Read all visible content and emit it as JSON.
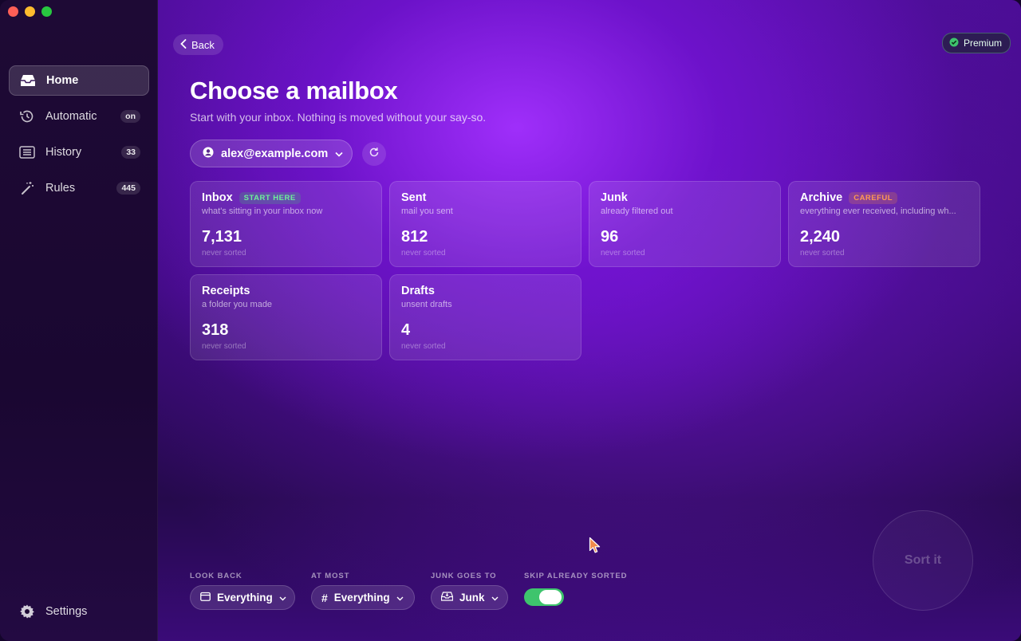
{
  "sidebar": {
    "items": [
      {
        "label": "Home",
        "icon": "inbox-tray-icon",
        "badge": ""
      },
      {
        "label": "Automatic",
        "icon": "history-clock-icon",
        "badge": "on"
      },
      {
        "label": "History",
        "icon": "list-icon",
        "badge": "33"
      },
      {
        "label": "Rules",
        "icon": "magic-wand-icon",
        "badge": "445"
      }
    ],
    "settings_label": "Settings"
  },
  "header": {
    "back_label": "Back",
    "premium_label": "Premium",
    "title": "Choose a mailbox",
    "subtitle": "Start with your inbox. Nothing is moved without your say-so."
  },
  "account": {
    "email": "alex@example.com"
  },
  "mailboxes": [
    {
      "name": "Inbox",
      "tag": "START HERE",
      "desc": "what's sitting in your inbox now",
      "count": "7,131",
      "status": "never sorted"
    },
    {
      "name": "Sent",
      "tag": "",
      "desc": "mail you sent",
      "count": "812",
      "status": "never sorted"
    },
    {
      "name": "Junk",
      "tag": "",
      "desc": "already filtered out",
      "count": "96",
      "status": "never sorted"
    },
    {
      "name": "Archive",
      "tag": "CAREFUL",
      "desc": "everything ever received, including wh...",
      "count": "2,240",
      "status": "never sorted"
    },
    {
      "name": "Receipts",
      "tag": "",
      "desc": "a folder you made",
      "count": "318",
      "status": "never sorted"
    },
    {
      "name": "Drafts",
      "tag": "",
      "desc": "unsent drafts",
      "count": "4",
      "status": "never sorted"
    }
  ],
  "controls": {
    "look_back": {
      "label": "LOOK BACK",
      "value": "Everything"
    },
    "at_most": {
      "label": "AT MOST",
      "value": "Everything"
    },
    "junk_goes_to": {
      "label": "JUNK GOES TO",
      "value": "Junk"
    },
    "skip_sorted": {
      "label": "SKIP ALREADY SORTED",
      "enabled": true
    }
  },
  "sort_button_label": "Sort it",
  "colors": {
    "accent_green": "#3ec46d",
    "tag_green": "#6ef09a",
    "tag_orange": "#ff9a52",
    "glow_purple": "#a330ff"
  }
}
